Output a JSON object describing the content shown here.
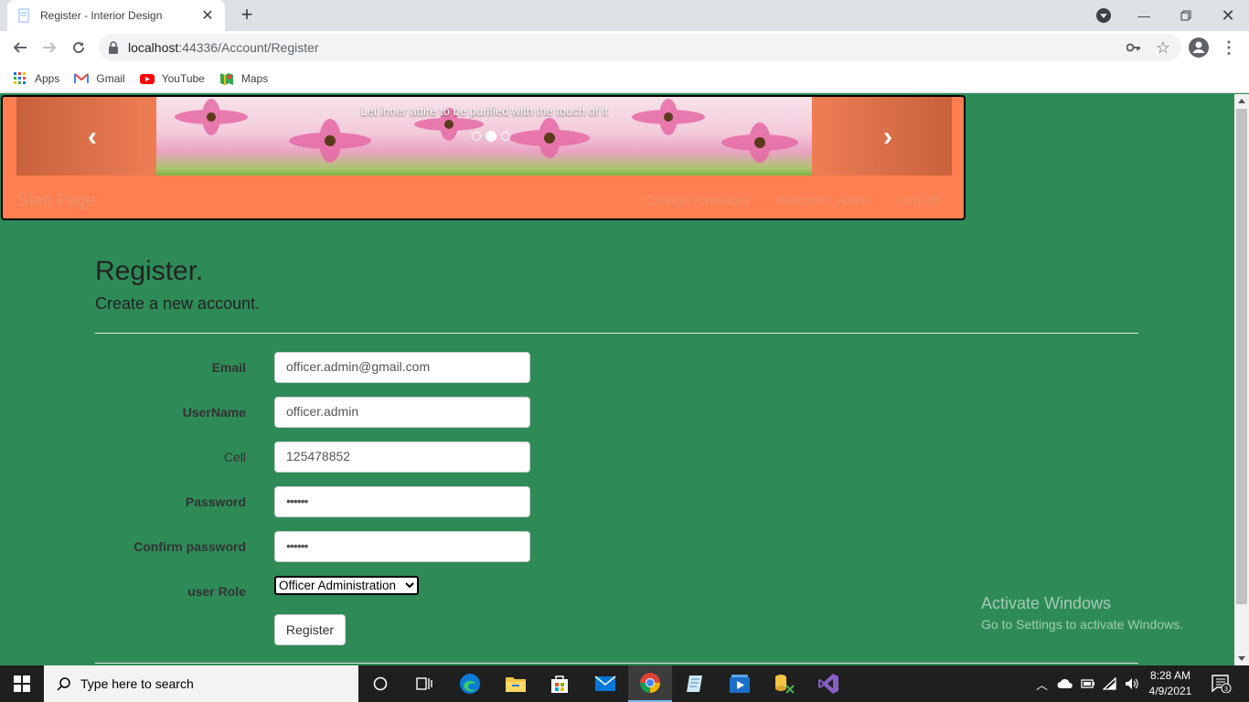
{
  "browser": {
    "tab_title": "Register - Interior Design",
    "url_host": "localhost",
    "url_path": ":44336/Account/Register",
    "bookmarks": [
      {
        "label": "Apps",
        "icon": "apps-grid-icon"
      },
      {
        "label": "Gmail",
        "icon": "gmail-icon"
      },
      {
        "label": "YouTube",
        "icon": "youtube-icon"
      },
      {
        "label": "Maps",
        "icon": "maps-icon"
      }
    ]
  },
  "header": {
    "carousel_caption": "Let inner attire to be purified with the touch of it",
    "brand": "Start Page",
    "nav": {
      "change_password": "Change Password",
      "welcome": "Welcome: admin",
      "logoff": "Log off"
    }
  },
  "form": {
    "title": "Register.",
    "subtitle": "Create a new account.",
    "email_label": "Email",
    "email_value": "officer.admin@gmail.com",
    "username_label": "UserName",
    "username_value": "officer.admin",
    "cell_label": "Cell",
    "cell_value": "125478852",
    "password_label": "Password",
    "password_value": "••••••",
    "confirm_label": "Confirm password",
    "confirm_value": "••••••",
    "role_label": "user Role",
    "role_value": "Officer Administration",
    "submit_label": "Register"
  },
  "watermark": {
    "line1": "Activate Windows",
    "line2": "Go to Settings to activate Windows."
  },
  "taskbar": {
    "search_placeholder": "Type here to search",
    "time": "8:28 AM",
    "date": "4/9/2021",
    "notification_count": "3"
  }
}
